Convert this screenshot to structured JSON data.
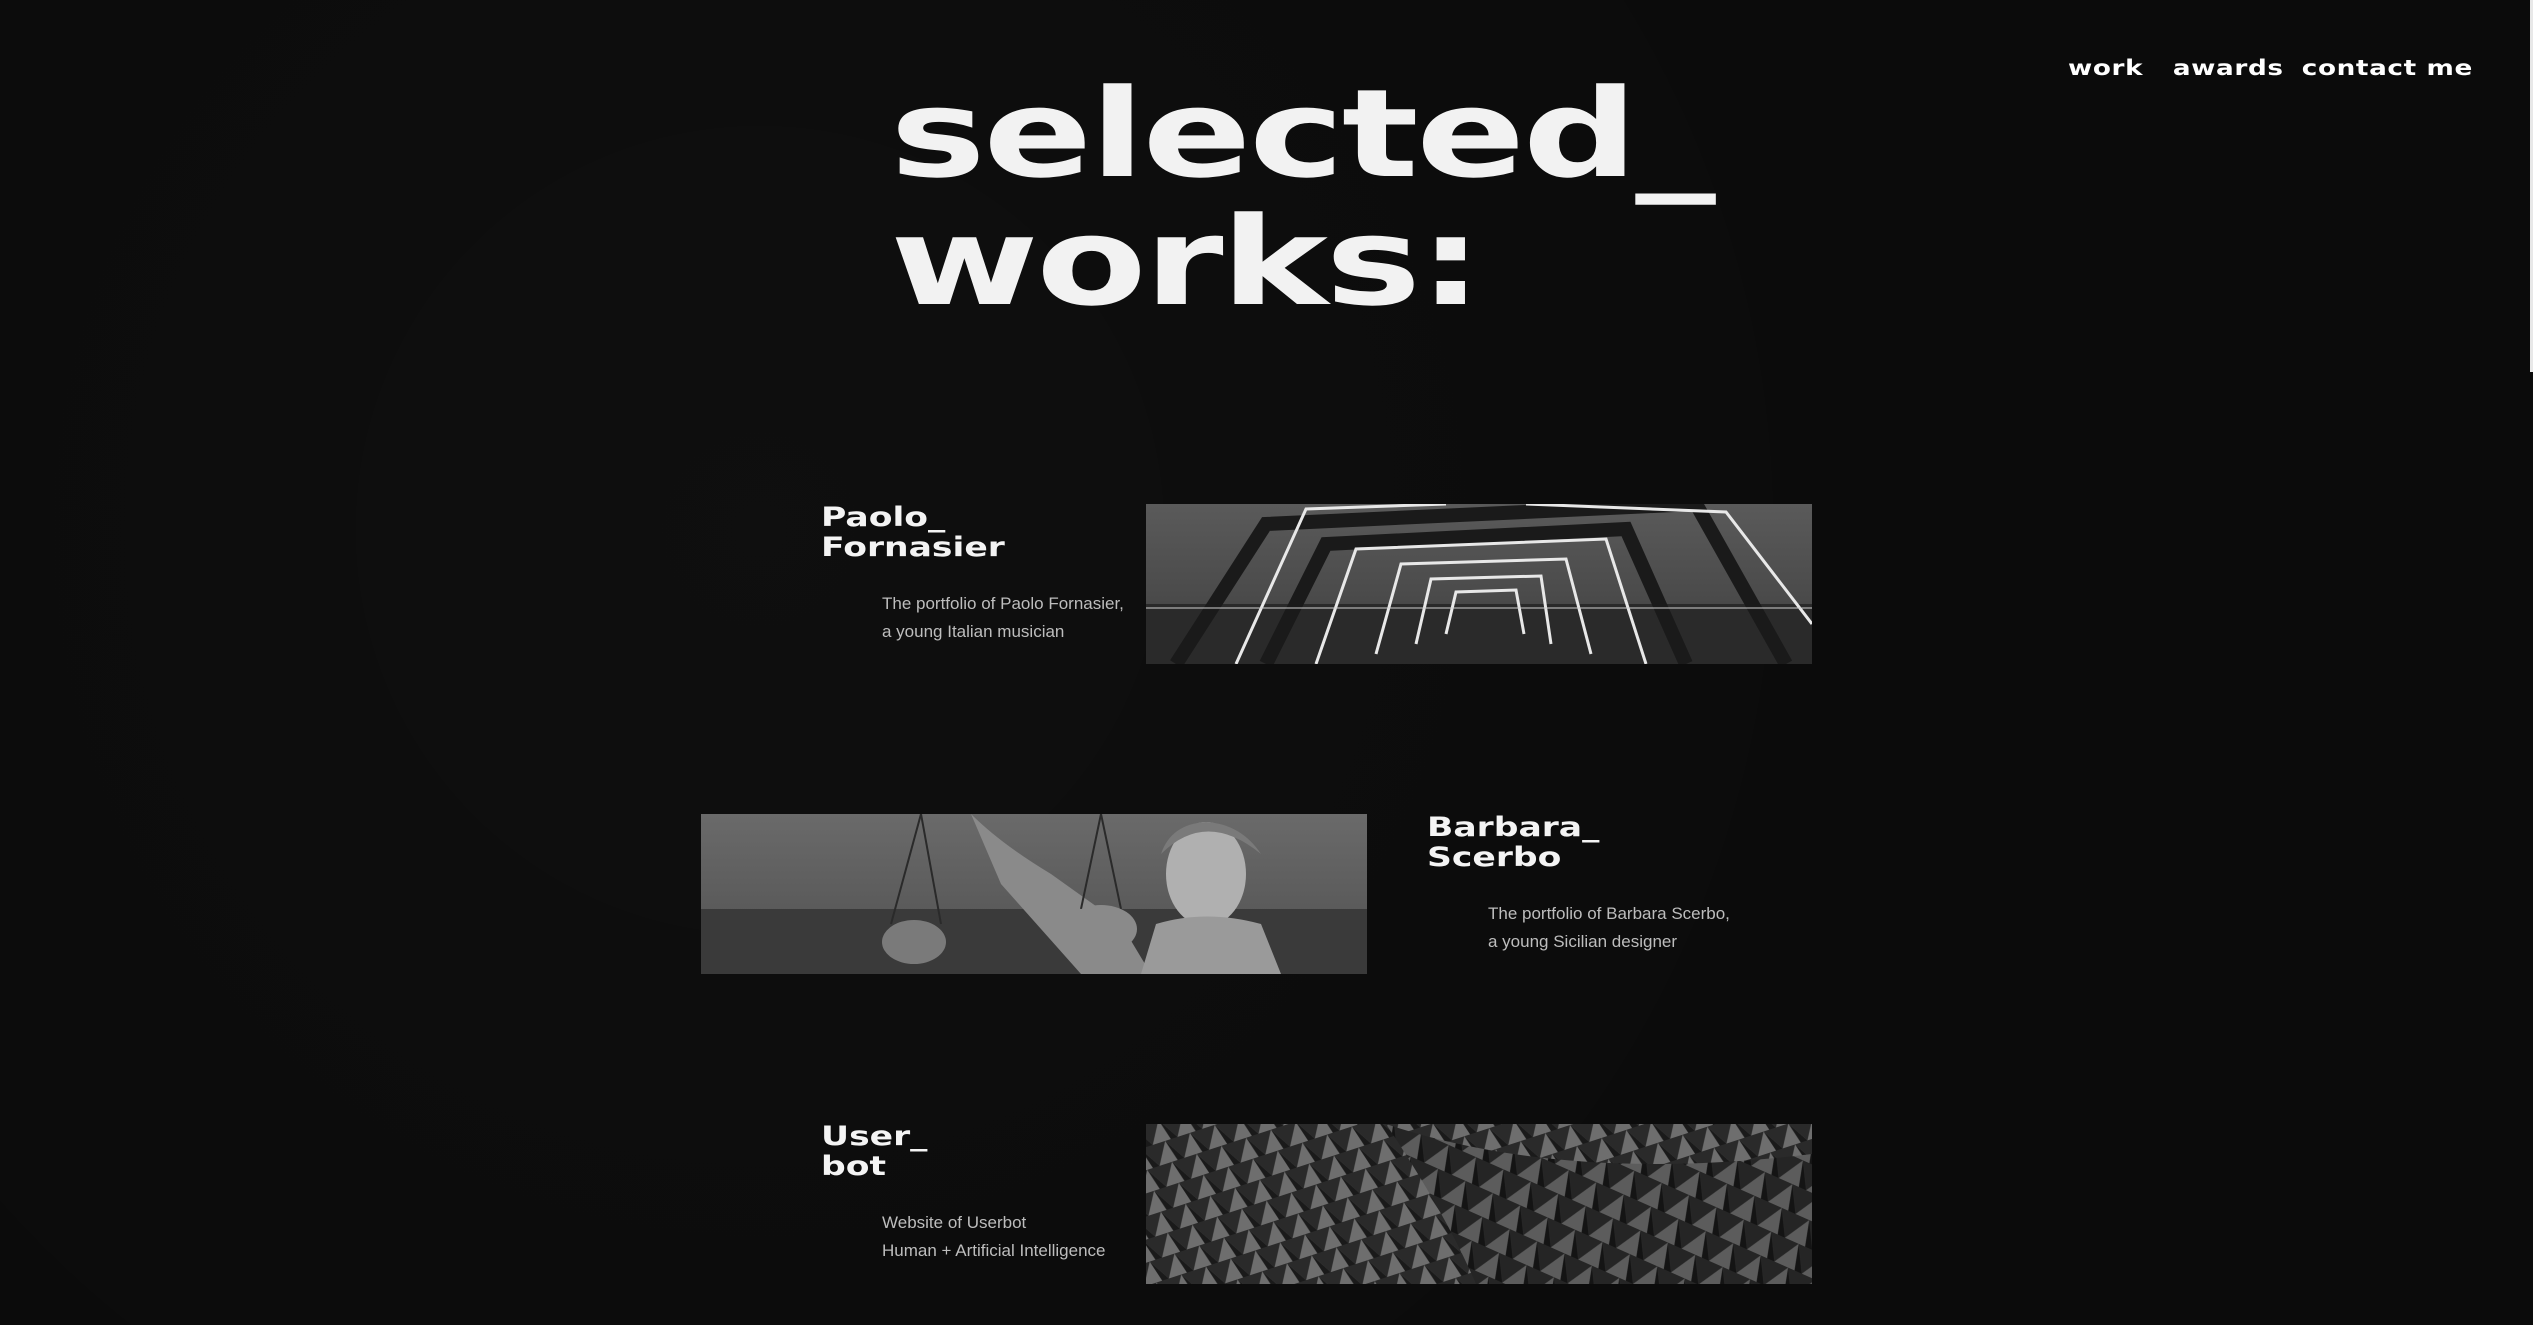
{
  "nav": {
    "work": "work",
    "awards": "awards",
    "contact": "contact me"
  },
  "hero": {
    "line1": "selected_",
    "line2": "works:"
  },
  "projects": [
    {
      "title_line1": "Paolo_",
      "title_line2": "Fornasier",
      "desc_line1": "The portfolio of Paolo Fornasier,",
      "desc_line2": "a young Italian musician",
      "image": "light-tunnel-bridge"
    },
    {
      "title_line1": "Barbara_",
      "title_line2": "Scerbo",
      "desc_line1": "The portfolio of Barbara Scerbo,",
      "desc_line2": "a young Sicilian designer",
      "image": "lady-justice-statue"
    },
    {
      "title_line1": "User_",
      "title_line2": "bot",
      "desc_line1": "Website of Userbot",
      "desc_line2": "Human + Artificial Intelligence",
      "image": "geometric-pattern-facade"
    }
  ]
}
